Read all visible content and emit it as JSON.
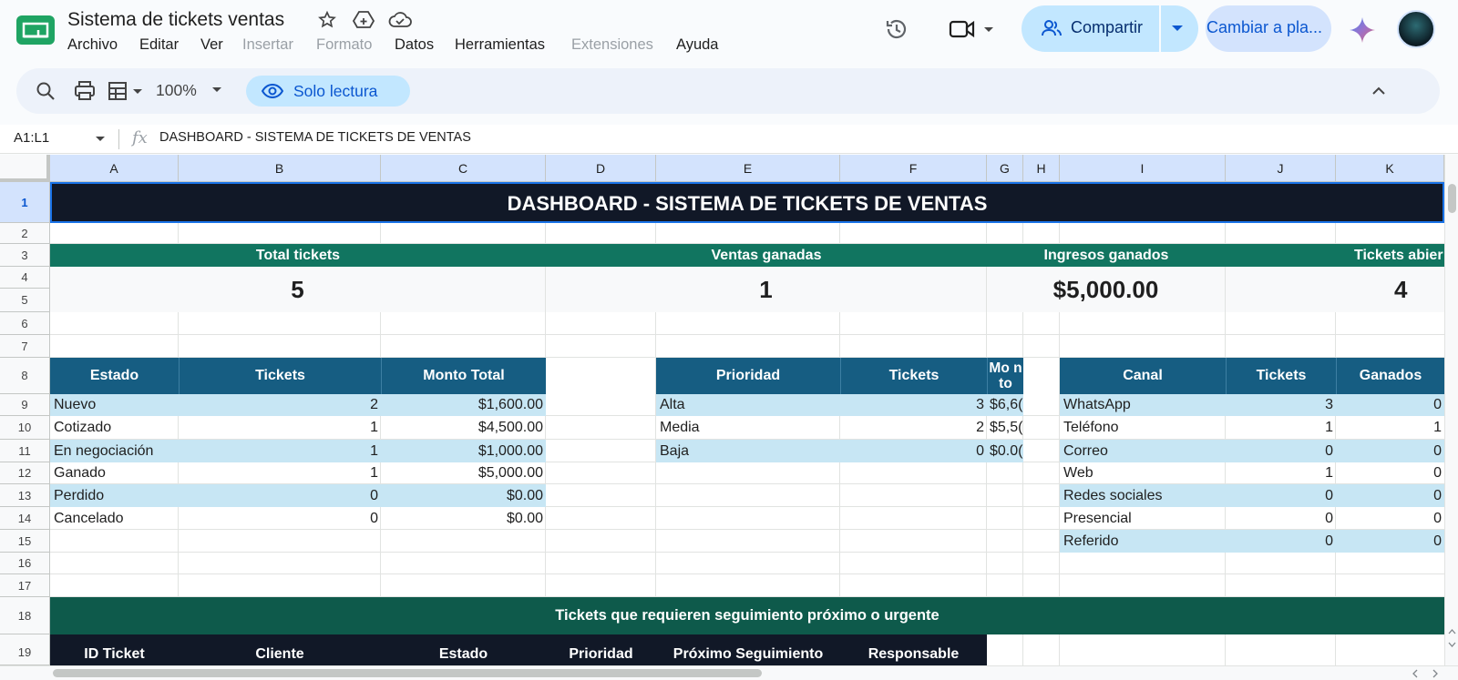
{
  "app": {
    "doc_title": "Sistema de tickets ventas",
    "menu": [
      "Archivo",
      "Editar",
      "Ver",
      "Insertar",
      "Formato",
      "Datos",
      "Herramientas",
      "Extensiones",
      "Ayuda"
    ],
    "share_label": "Compartir",
    "switch_label": "Cambiar a pla...",
    "accent": "#c2e7ff"
  },
  "toolbar": {
    "zoom": "100%",
    "readonly_label": "Solo lectura"
  },
  "formula_bar": {
    "name_box": "A1:L1",
    "fx": "fx",
    "content": "DASHBOARD - SISTEMA DE TICKETS DE VENTAS"
  },
  "sheet": {
    "columns": [
      "A",
      "B",
      "C",
      "D",
      "E",
      "F",
      "G",
      "H",
      "I",
      "J",
      "K"
    ],
    "rows": [
      "1",
      "2",
      "3",
      "4",
      "5",
      "6",
      "7",
      "8",
      "9",
      "10",
      "11",
      "12",
      "13",
      "14",
      "15",
      "16",
      "17",
      "18",
      "19"
    ],
    "title": "DASHBOARD - SISTEMA DE TICKETS DE VENTAS",
    "kpis": [
      {
        "label": "Total tickets",
        "value": "5"
      },
      {
        "label": "Ventas ganadas",
        "value": "1"
      },
      {
        "label": "Ingresos ganados",
        "value": "$5,000.00"
      },
      {
        "label": "Tickets abier",
        "value": "4"
      }
    ],
    "estado_table": {
      "headers": [
        "Estado",
        "Tickets",
        "Monto Total"
      ],
      "rows": [
        [
          "Nuevo",
          "2",
          "$1,600.00"
        ],
        [
          "Cotizado",
          "1",
          "$4,500.00"
        ],
        [
          "En negociación",
          "1",
          "$1,000.00"
        ],
        [
          "Ganado",
          "1",
          "$5,000.00"
        ],
        [
          "Perdido",
          "0",
          "$0.00"
        ],
        [
          "Cancelado",
          "0",
          "$0.00"
        ]
      ]
    },
    "prioridad_table": {
      "headers": [
        "Prioridad",
        "Tickets",
        "Mo nto"
      ],
      "rows": [
        [
          "Alta",
          "3",
          "$6,6("
        ],
        [
          "Media",
          "2",
          "$5,5("
        ],
        [
          "Baja",
          "0",
          "$0.0("
        ]
      ]
    },
    "canal_table": {
      "headers": [
        "Canal",
        "Tickets",
        "Ganados"
      ],
      "rows": [
        [
          "WhatsApp",
          "3",
          "0"
        ],
        [
          "Teléfono",
          "1",
          "1"
        ],
        [
          "Correo",
          "0",
          "0"
        ],
        [
          "Web",
          "1",
          "0"
        ],
        [
          "Redes sociales",
          "0",
          "0"
        ],
        [
          "Presencial",
          "0",
          "0"
        ],
        [
          "Referido",
          "0",
          "0"
        ]
      ]
    },
    "followup": {
      "title": "Tickets que requieren seguimiento próximo o urgente",
      "headers": [
        "ID Ticket",
        "Cliente",
        "Estado",
        "Prioridad",
        "Próximo Seguimiento",
        "Responsable"
      ]
    },
    "colors": {
      "title_bg": "#111827",
      "kpi_bg": "#117560",
      "table_header_bg": "#165d82",
      "row_light": "#c7e6f4",
      "followup_bg": "#0e5a4b"
    }
  }
}
